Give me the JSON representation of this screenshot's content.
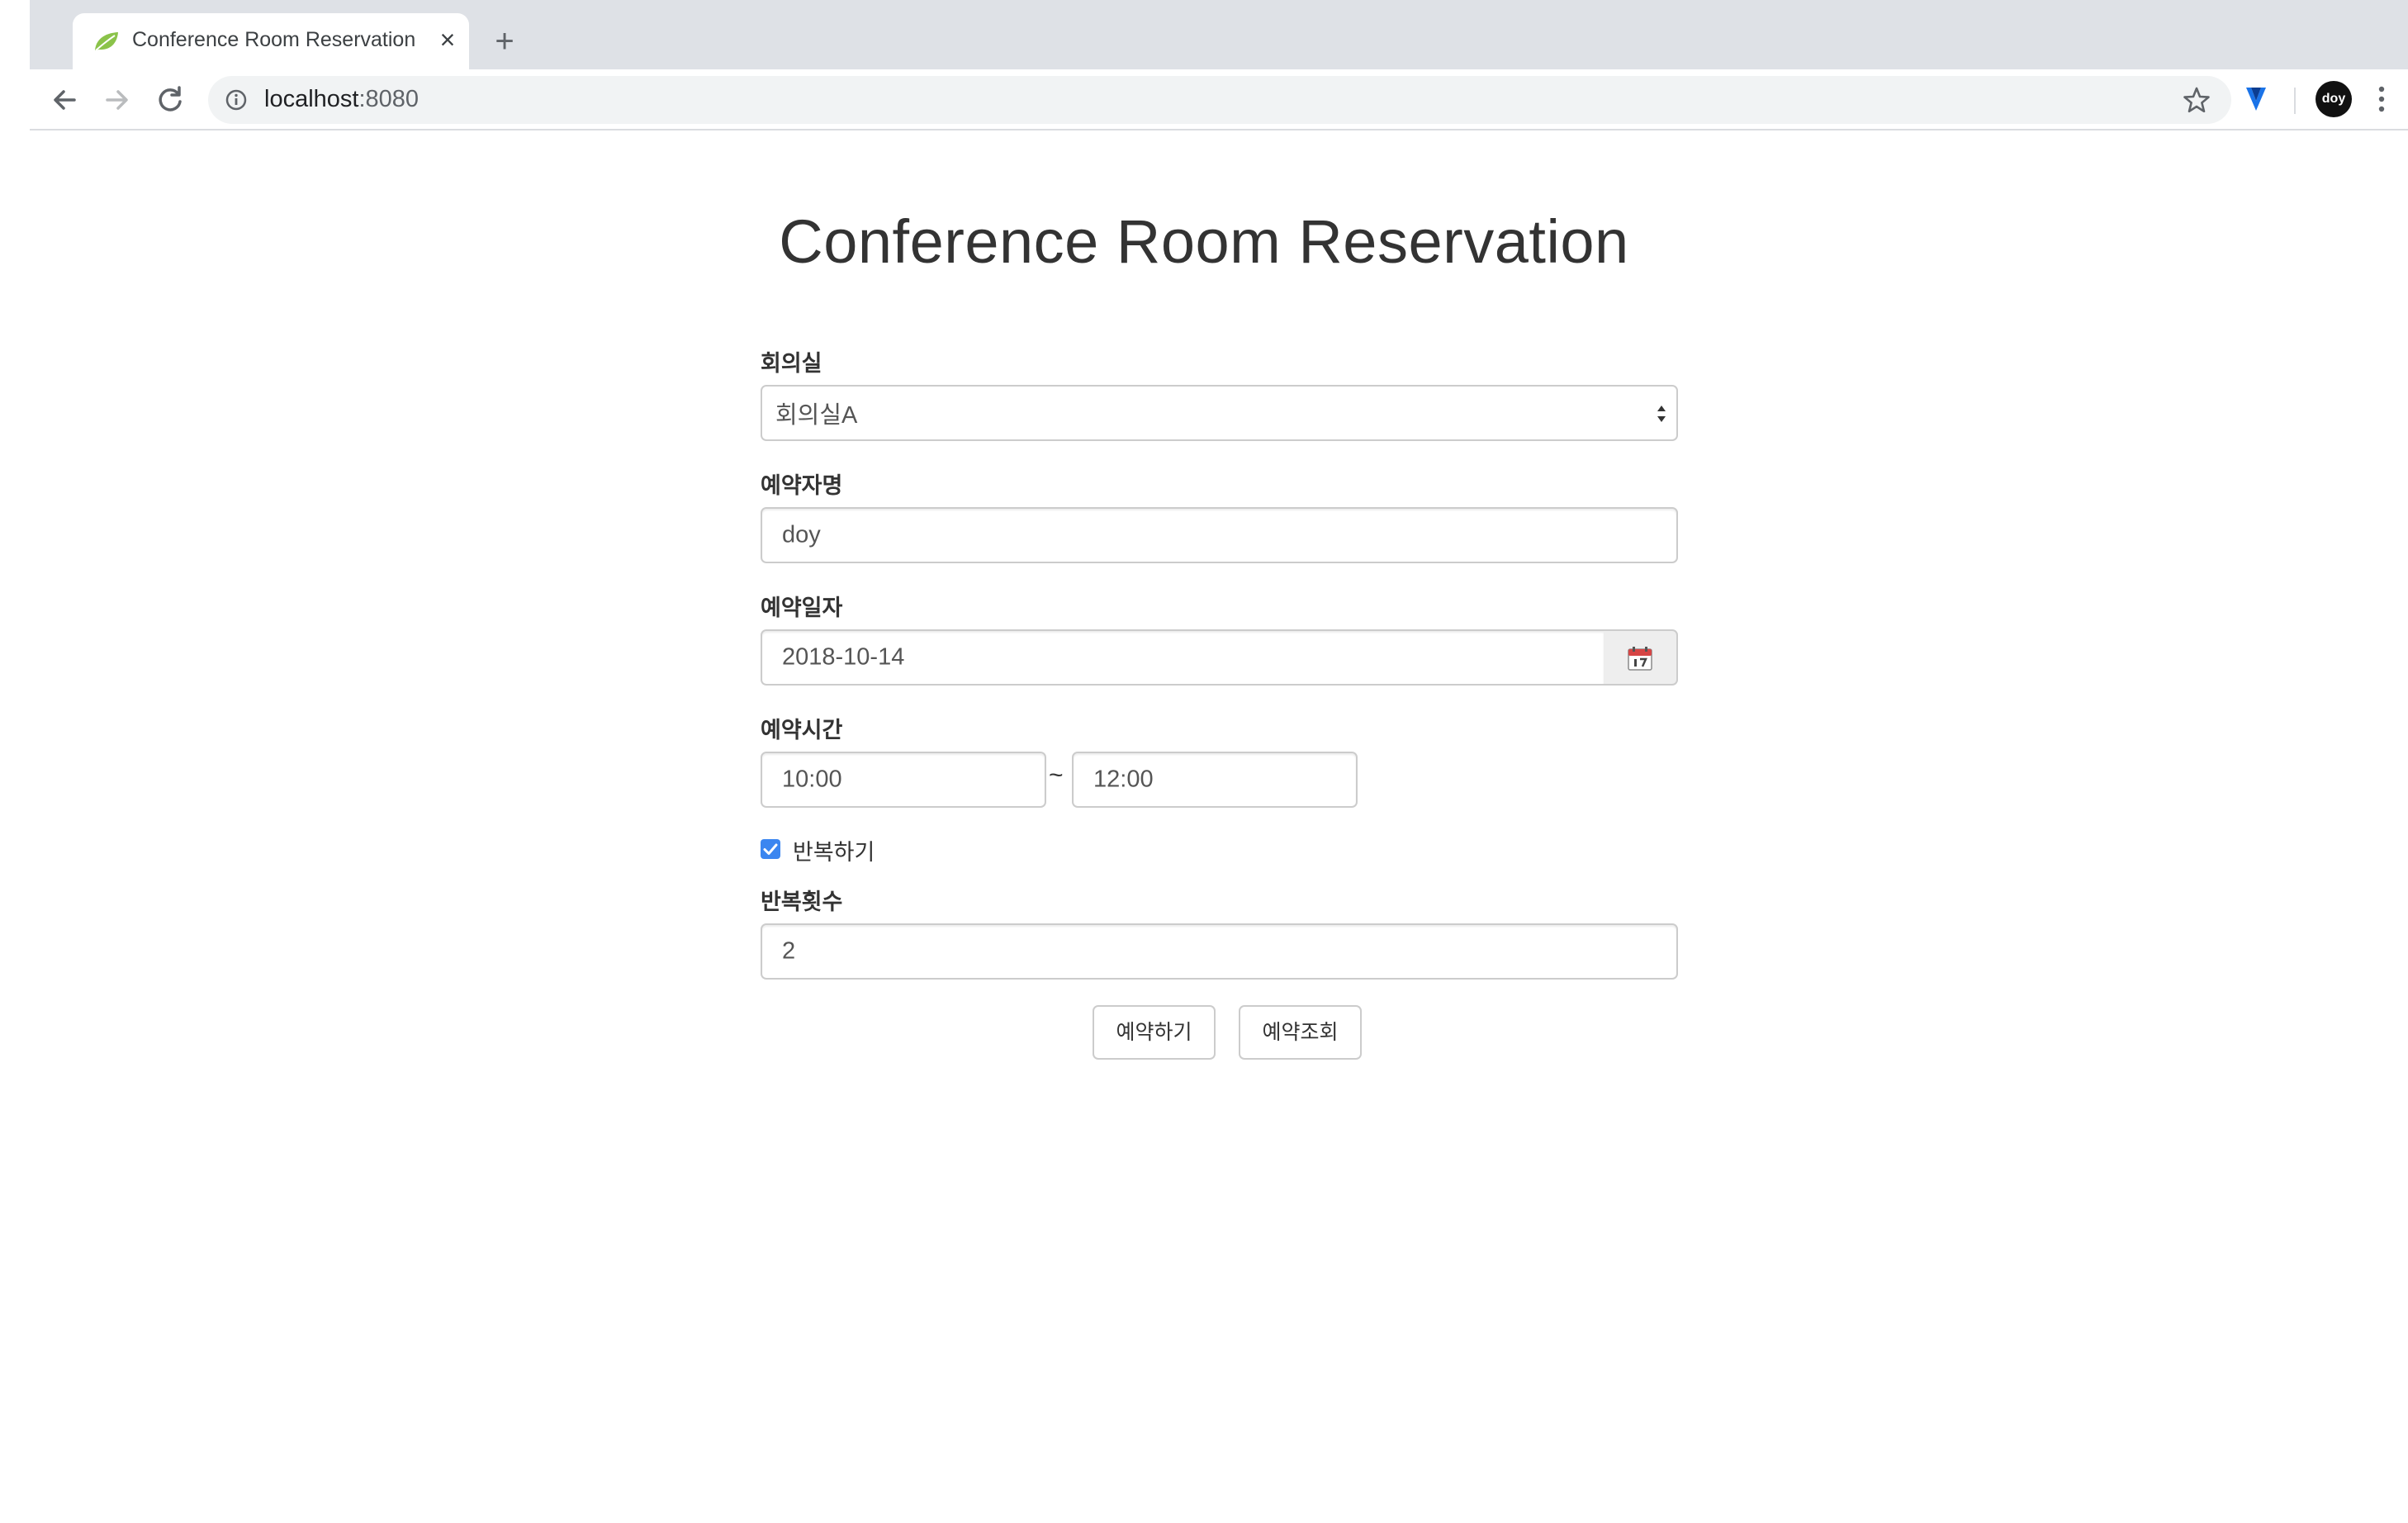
{
  "browser": {
    "tab_title": "Conference Room Reservation",
    "new_tab_icon": "plus-icon",
    "url_host": "localhost",
    "url_port": ":8080",
    "profile_initials": "doy"
  },
  "page": {
    "title": "Conference Room Reservation"
  },
  "form": {
    "room_label": "회의실",
    "room_value": "회의실A",
    "name_label": "예약자명",
    "name_value": "doy",
    "date_label": "예약일자",
    "date_value": "2018-10-14",
    "time_label": "예약시간",
    "start_time": "10:00",
    "time_separator": "~",
    "end_time": "12:00",
    "repeat_checkbox_label": "반복하기",
    "repeat_checked": true,
    "repeat_count_label": "반복횟수",
    "repeat_count_value": "2"
  },
  "actions": {
    "reserve_label": "예약하기",
    "lookup_label": "예약조회"
  },
  "colors": {
    "checkbox_accent": "#3b86f0",
    "tab_bar": "#dee1e6",
    "omnibox": "#f1f3f4"
  }
}
